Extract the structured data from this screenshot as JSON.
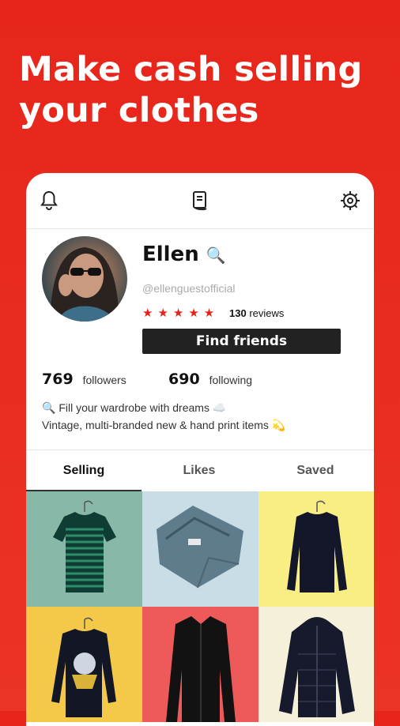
{
  "headline": "Make cash selling your clothes",
  "profile": {
    "name": "Ellen",
    "name_emoji": "🔍",
    "handle": "@ellenguestofficial",
    "stars": "★★★★★",
    "review_count": "130",
    "reviews_label": "reviews",
    "find_friends_label": "Find friends",
    "followers_count": "769",
    "followers_label": "followers",
    "following_count": "690",
    "following_label": "following",
    "bio_line1": "🔍 Fill your wardrobe with dreams ☁️",
    "bio_line2": "Vintage, multi-branded new & hand print items 💫"
  },
  "tabs": [
    {
      "label": "Selling",
      "active": true
    },
    {
      "label": "Likes",
      "active": false
    },
    {
      "label": "Saved",
      "active": false
    }
  ],
  "grid_items": [
    {
      "item": "striped-tshirt",
      "bg": "#88b9a8"
    },
    {
      "item": "denim-jeans",
      "bg": "#c9dde6"
    },
    {
      "item": "black-sweater",
      "bg": "#f9ee83"
    },
    {
      "item": "graphic-sweatshirt",
      "bg": "#f4c94a"
    },
    {
      "item": "black-jacket",
      "bg": "#ee5a5a"
    },
    {
      "item": "puffer-coat",
      "bg": "#f4f0d9"
    }
  ],
  "colors": {
    "brand_red": "#e7251b",
    "button_dark": "#222222"
  }
}
